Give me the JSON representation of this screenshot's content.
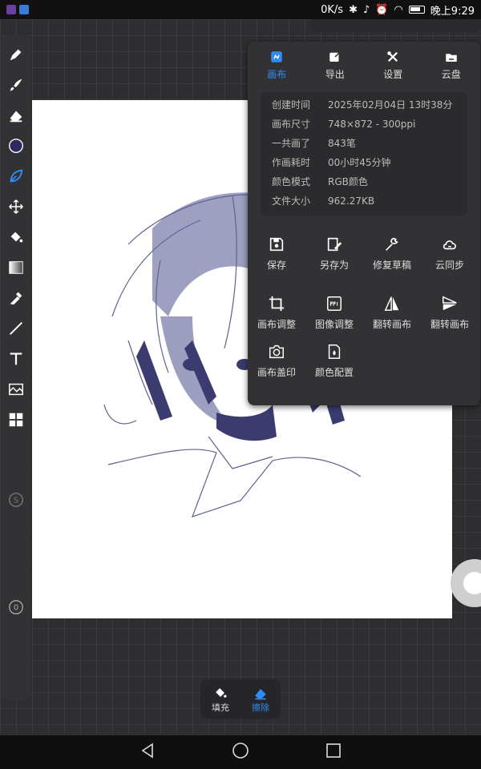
{
  "status": {
    "speed": "0K/s",
    "time": "晚上9:29",
    "battery_level": 0.8
  },
  "panel": {
    "tabs": [
      {
        "label": "画布",
        "icon": "canvas-icon",
        "active": true
      },
      {
        "label": "导出",
        "icon": "export-icon",
        "active": false
      },
      {
        "label": "设置",
        "icon": "settings-icon",
        "active": false
      },
      {
        "label": "云盘",
        "icon": "cloud-drive-icon",
        "active": false
      }
    ],
    "info": [
      {
        "label": "创建时间",
        "value": "2025年02月04日 13时38分"
      },
      {
        "label": "画布尺寸",
        "value": "748×872 - 300ppi"
      },
      {
        "label": "一共画了",
        "value": "843笔"
      },
      {
        "label": "作画耗时",
        "value": "00小时45分钟"
      },
      {
        "label": "颜色模式",
        "value": "RGB颜色"
      },
      {
        "label": "文件大小",
        "value": "962.27KB"
      }
    ],
    "actions_row1": [
      {
        "label": "保存",
        "icon": "save-icon"
      },
      {
        "label": "另存为",
        "icon": "save-as-icon"
      },
      {
        "label": "修复草稿",
        "icon": "wrench-icon"
      },
      {
        "label": "云同步",
        "icon": "cloud-sync-icon"
      }
    ],
    "actions_row2": [
      {
        "label": "画布调整",
        "icon": "crop-icon"
      },
      {
        "label": "图像调整",
        "icon": "ppi-icon"
      },
      {
        "label": "翻转画布",
        "icon": "flip-horizontal-icon"
      },
      {
        "label": "翻转画布",
        "icon": "flip-vertical-icon"
      }
    ],
    "actions_row3": [
      {
        "label": "画布盖印",
        "icon": "camera-icon"
      },
      {
        "label": "颜色配置",
        "icon": "color-profile-icon"
      }
    ]
  },
  "toolbar": {
    "layer_s": "S",
    "layer_0": "0"
  },
  "minibar": {
    "fill": "填充",
    "erase": "擦除"
  },
  "colors": {
    "accent": "#2f8df5",
    "current_color": "#2c2a5e"
  }
}
